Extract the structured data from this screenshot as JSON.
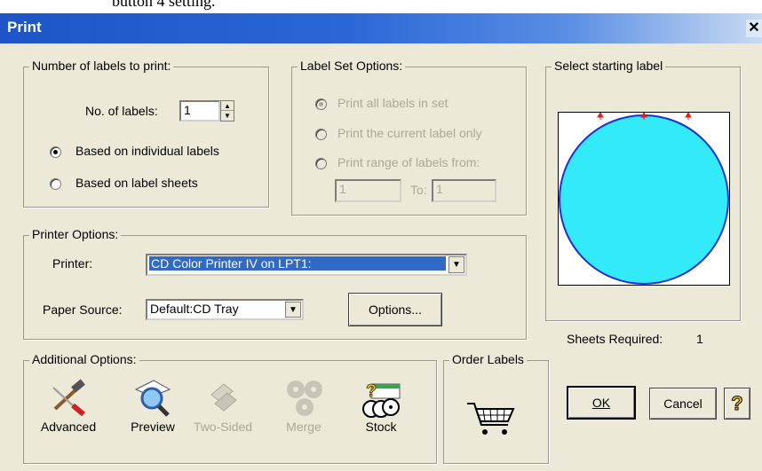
{
  "window": {
    "title": "Print",
    "behind_text": "button 4 setting."
  },
  "labels_group": {
    "legend": "Number of labels to print:",
    "no_of_labels_label": "No. of labels:",
    "no_of_labels_value": "1",
    "radio_individual": "Based on individual labels",
    "radio_sheets": "Based on label sheets",
    "selected": "individual"
  },
  "label_set": {
    "legend": "Label Set Options:",
    "opt_all": "Print all labels in set",
    "opt_current": "Print the current label only",
    "opt_range": "Print range of labels from:",
    "range_from": "1",
    "to_label": "To:",
    "range_to": "1"
  },
  "start_label": {
    "legend": "Select starting label"
  },
  "printer_options": {
    "legend": "Printer Options:",
    "printer_label": "Printer:",
    "printer_value": "CD Color Printer IV    on LPT1:",
    "paper_label": "Paper Source:",
    "paper_value": "Default:CD Tray",
    "options_button": "Options..."
  },
  "sheets": {
    "label": "Sheets Required:",
    "value": "1"
  },
  "additional": {
    "legend": "Additional Options:",
    "advanced": "Advanced",
    "preview": "Preview",
    "two_sided": "Two-Sided",
    "merge": "Merge",
    "stock": "Stock"
  },
  "order": {
    "legend": "Order Labels"
  },
  "buttons": {
    "ok": "OK",
    "cancel": "Cancel",
    "help": "?"
  },
  "colors": {
    "disc": "#33eaf8",
    "disc_outline": "#1c2fd8",
    "selection": "#316ac5",
    "title_bar": "#2a66d6"
  }
}
